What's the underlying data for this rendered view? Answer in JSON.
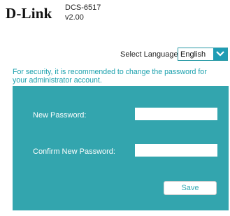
{
  "header": {
    "logo_text": "D-Link",
    "model": "DCS-6517",
    "version": "v2.00"
  },
  "language": {
    "label": "Select Language:",
    "selected": "English"
  },
  "notice": {
    "text": "For security, it is recommended to change the password for your administrator account."
  },
  "form": {
    "new_password_label": "New Password:",
    "new_password_value": "",
    "confirm_password_label": "Confirm New Password:",
    "confirm_password_value": "",
    "save_label": "Save"
  },
  "colors": {
    "accent": "#33a5ae",
    "notice_text": "#1aa0ad",
    "dropdown_arrow_bg": "#1f9cb4"
  },
  "icons": {
    "dropdown": "chevron-down-icon"
  }
}
